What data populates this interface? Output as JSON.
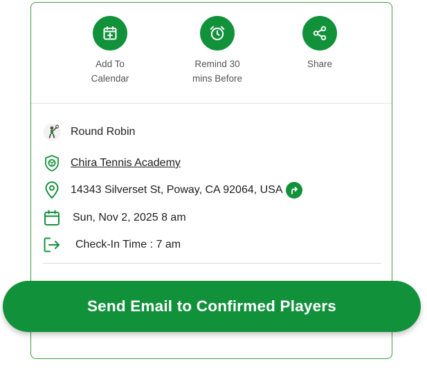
{
  "actions": [
    {
      "line1": "Add To",
      "line2": "Calendar",
      "icon": "calendar-plus-icon"
    },
    {
      "line1": "Remind 30",
      "line2": "mins Before",
      "icon": "alarm-clock-icon"
    },
    {
      "line1": "Share",
      "line2": "",
      "icon": "share-icon"
    }
  ],
  "event": {
    "type": "Round Robin",
    "club": "Chira Tennis Academy",
    "address": "14343 Silverset St, Poway, CA 92064, USA",
    "date": "Sun, Nov 2, 2025 8 am",
    "checkin": "Check-In Time : 7 am"
  },
  "send_button": "Send Email to Confirmed Players",
  "colors": {
    "accent": "#12913b",
    "border": "#3a9c3f"
  }
}
